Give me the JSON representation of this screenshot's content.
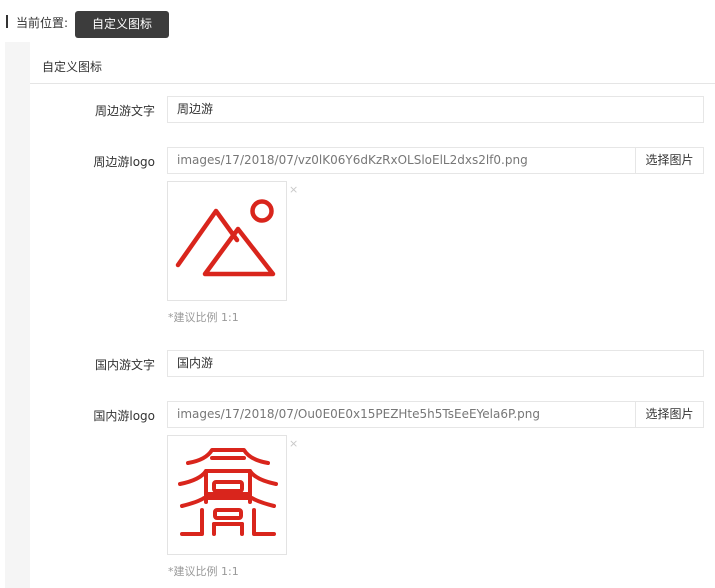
{
  "breadcrumb": {
    "label": "当前位置:",
    "current": "自定义图标"
  },
  "card": {
    "title": "自定义图标"
  },
  "form": {
    "nearby_text": {
      "label": "周边游文字",
      "value": "周边游"
    },
    "nearby_logo": {
      "label": "周边游logo",
      "path": "images/17/2018/07/vz0lK06Y6dKzRxOLSloElL2dxs2lf0.png",
      "pick_label": "选择图片",
      "close": "×",
      "icon": "mountain-sun-icon",
      "hint": "*建议比例 1:1"
    },
    "domestic_text": {
      "label": "国内游文字",
      "value": "国内游"
    },
    "domestic_logo": {
      "label": "国内游logo",
      "path": "images/17/2018/07/Ou0E0E0x15PEZHte5h5TsEeEYela6P.png",
      "pick_label": "选择图片",
      "close": "×",
      "icon": "pagoda-icon",
      "hint": "*建议比例 1:1"
    }
  },
  "colors": {
    "icon_red": "#d9251c",
    "breadcrumb_button_bg": "#3c3c3c"
  }
}
